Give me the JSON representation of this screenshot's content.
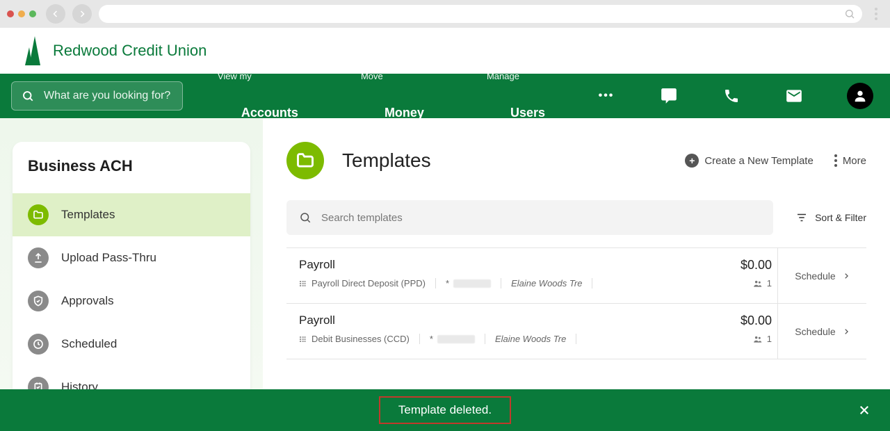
{
  "brand": {
    "name": "Redwood Credit Union"
  },
  "topnav": {
    "search_placeholder": "What are you looking for?",
    "items": [
      {
        "sub": "View my",
        "main": "Accounts"
      },
      {
        "sub": "Move",
        "main": "Money"
      },
      {
        "sub": "Manage",
        "main": "Users"
      }
    ]
  },
  "sidebar": {
    "title": "Business ACH",
    "items": [
      {
        "label": "Templates",
        "icon": "folder-icon",
        "active": true
      },
      {
        "label": "Upload Pass-Thru",
        "icon": "upload-icon",
        "active": false
      },
      {
        "label": "Approvals",
        "icon": "shield-icon",
        "active": false
      },
      {
        "label": "Scheduled",
        "icon": "clock-icon",
        "active": false
      },
      {
        "label": "History",
        "icon": "history-icon",
        "active": false
      }
    ]
  },
  "main": {
    "title": "Templates",
    "create_label": "Create a New Template",
    "more_label": "More",
    "search_placeholder": "Search templates",
    "sort_filter_label": "Sort & Filter",
    "schedule_label": "Schedule",
    "templates": [
      {
        "name": "Payroll",
        "amount": "$0.00",
        "type": "Payroll Direct Deposit (PPD)",
        "acct_prefix": "*",
        "owner": "Elaine Woods Tre",
        "recipients": "1"
      },
      {
        "name": "Payroll",
        "amount": "$0.00",
        "type": "Debit Businesses (CCD)",
        "acct_prefix": "*",
        "owner": "Elaine Woods Tre",
        "recipients": "1"
      }
    ]
  },
  "toast": {
    "message": "Template deleted."
  }
}
